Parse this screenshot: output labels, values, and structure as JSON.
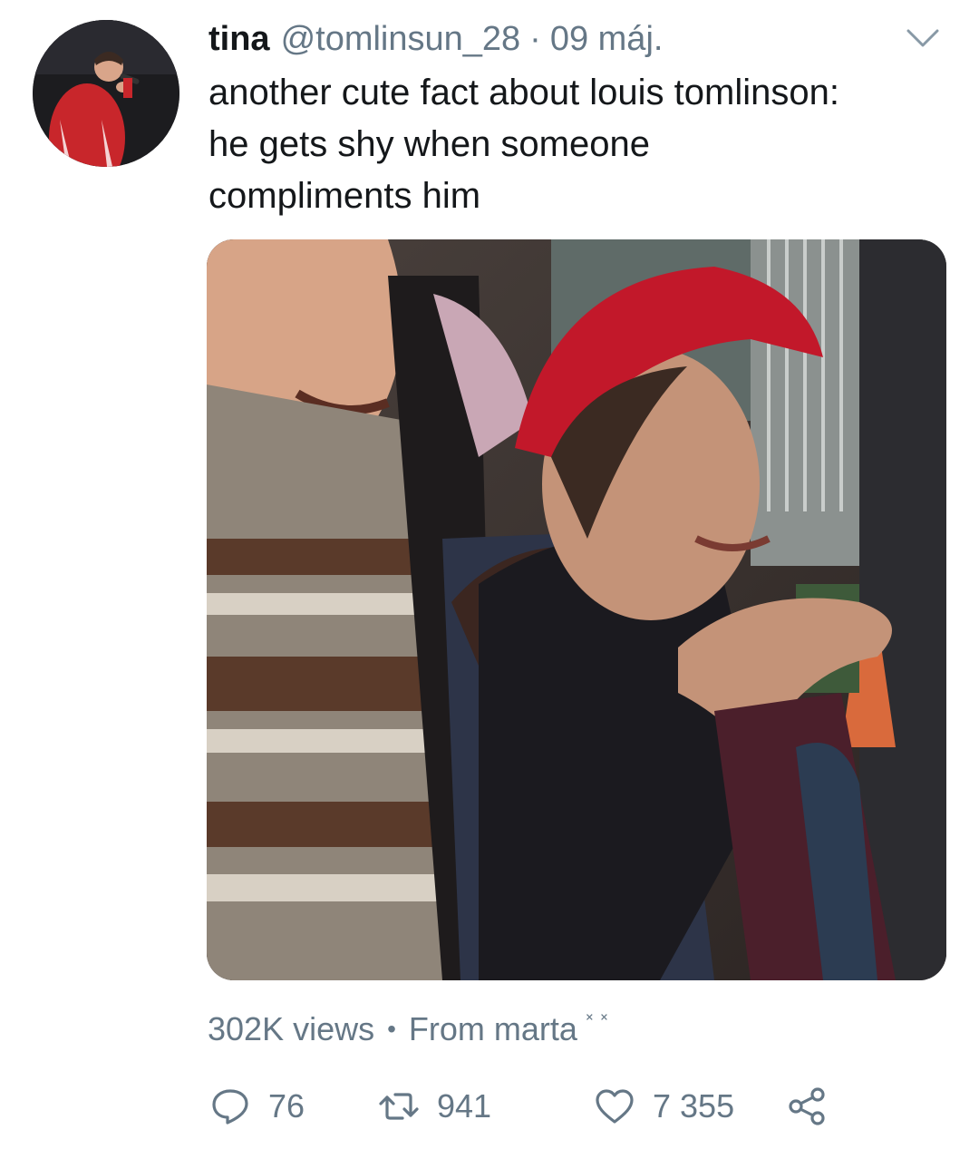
{
  "tweet": {
    "author_name": "tina",
    "handle": "@tomlinsun_28",
    "separator": "·",
    "date": "09 máj.",
    "text_lines": [
      "another cute fact about louis tomlinson:",
      "he gets shy when someone",
      "compliments him"
    ]
  },
  "media": {
    "type": "video thumbnail"
  },
  "meta": {
    "views": "302K views",
    "dot": "•",
    "from": "From marta",
    "emoticon": "˟ ˟"
  },
  "actions": {
    "replies": "76",
    "retweets": "941",
    "likes": "7 355"
  },
  "icons": {
    "caret": "chevron-down-icon",
    "reply": "reply-icon",
    "retweet": "retweet-icon",
    "like": "heart-icon",
    "share": "share-icon"
  },
  "colors": {
    "text": "#14171a",
    "secondary": "#657786",
    "background": "#ffffff"
  }
}
